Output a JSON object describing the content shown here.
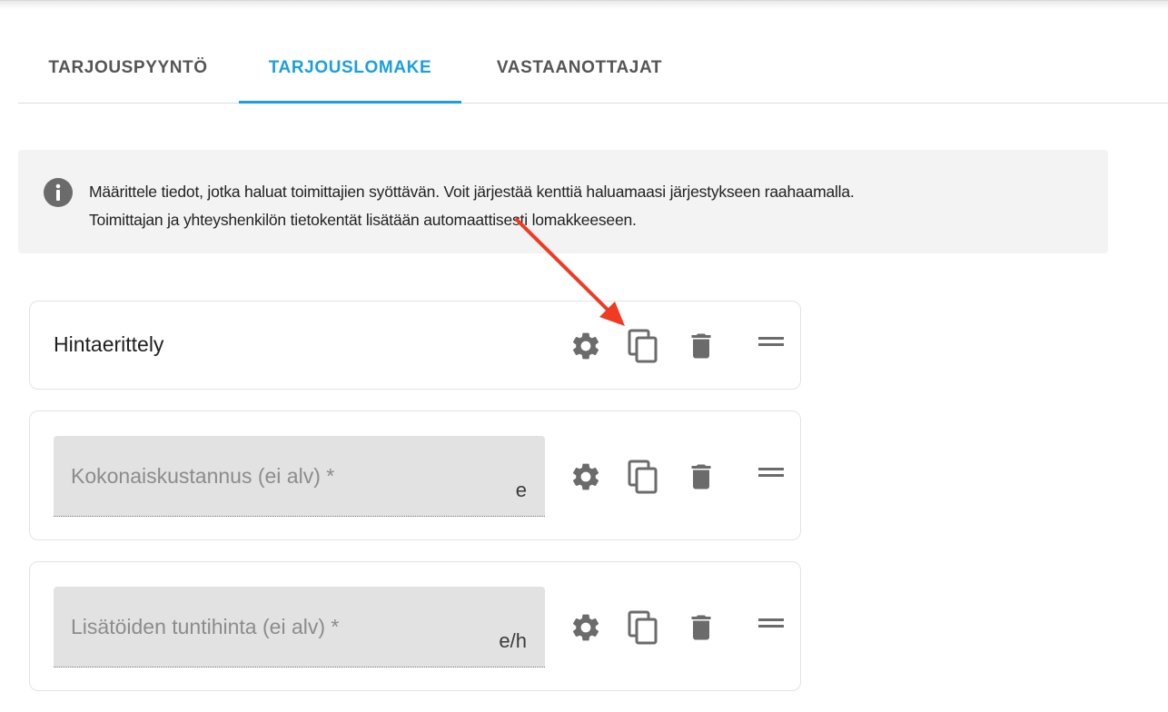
{
  "tabs": [
    {
      "label": "TARJOUSPYYNTÖ",
      "active": false
    },
    {
      "label": "TARJOUSLOMAKE",
      "active": true
    },
    {
      "label": "VASTAANOTTAJAT",
      "active": false
    }
  ],
  "info": {
    "icon": "info-icon",
    "line1": "Määrittele tiedot, jotka haluat toimittajien syöttävän. Voit järjestää kenttiä haluamaasi järjestykseen raahaamalla.",
    "line2": "Toimittajan ja yhteyshenkilön tietokentät lisätään automaattisesti lomakkeeseen."
  },
  "cards": [
    {
      "type": "heading",
      "title": "Hintaerittely"
    },
    {
      "type": "field",
      "label": "Kokonaiskustannus (ei alv) *",
      "suffix": "e"
    },
    {
      "type": "field",
      "label": "Lisätöiden tuntihinta (ei alv) *",
      "suffix": "e/h"
    }
  ],
  "card_actions": [
    "gear-icon",
    "copy-icon",
    "trash-icon",
    "drag-handle-icon"
  ],
  "colors": {
    "accent": "#1a9fe0",
    "icon": "#6b6b6b",
    "annotation_arrow": "#f03a21",
    "info_background": "#f3f3f3",
    "field_background": "#e2e2e2"
  }
}
